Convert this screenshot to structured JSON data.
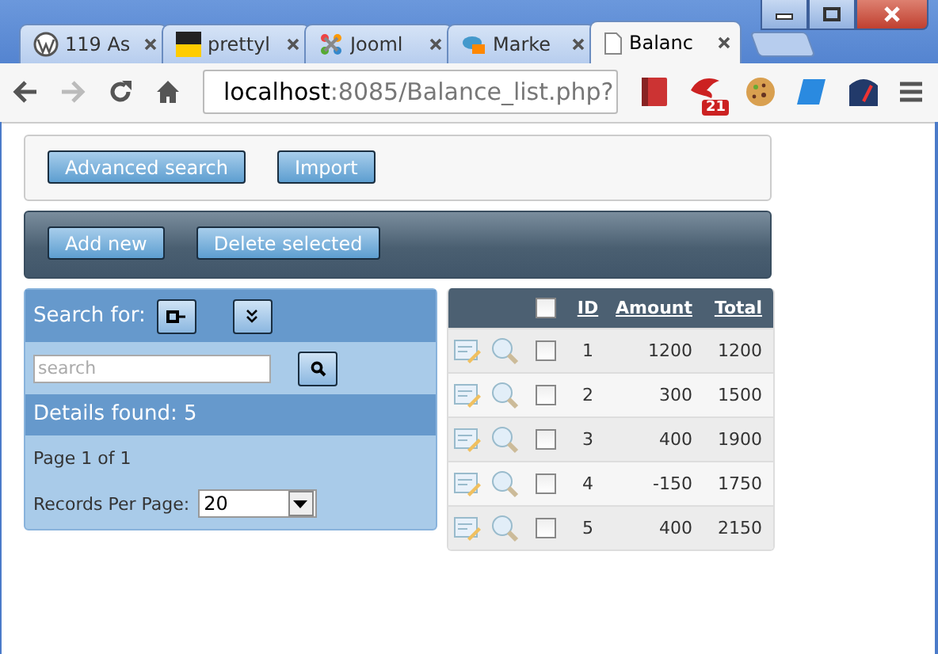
{
  "browser": {
    "tabs": [
      {
        "title": "119 As",
        "selected": false
      },
      {
        "title": "prettyl",
        "selected": false
      },
      {
        "title": "Jooml",
        "selected": false
      },
      {
        "title": "Marke",
        "selected": false
      },
      {
        "title": "Balanc",
        "selected": true
      }
    ],
    "url": {
      "host": "localhost",
      "path": ":8085/Balance_list.php?"
    },
    "forward_disabled": true,
    "extension_badge": "21"
  },
  "top_buttons": [
    "Advanced search",
    "Import"
  ],
  "action_buttons": [
    "Add new",
    "Delete selected"
  ],
  "search_panel": {
    "title": "Search for:",
    "placeholder": "search",
    "details": "Details found: 5",
    "page_info": "Page 1 of 1",
    "records_label": "Records Per Page:",
    "records_value": "20"
  },
  "table": {
    "select_all": false,
    "columns": [
      "ID",
      "Amount",
      "Total"
    ],
    "rows": [
      {
        "id": "1",
        "amount": "1200",
        "total": "1200",
        "checked": false
      },
      {
        "id": "2",
        "amount": "300",
        "total": "1500",
        "checked": false
      },
      {
        "id": "3",
        "amount": "400",
        "total": "1900",
        "checked": false
      },
      {
        "id": "4",
        "amount": "-150",
        "total": "1750",
        "checked": false
      },
      {
        "id": "5",
        "amount": "400",
        "total": "2150",
        "checked": false
      }
    ]
  }
}
